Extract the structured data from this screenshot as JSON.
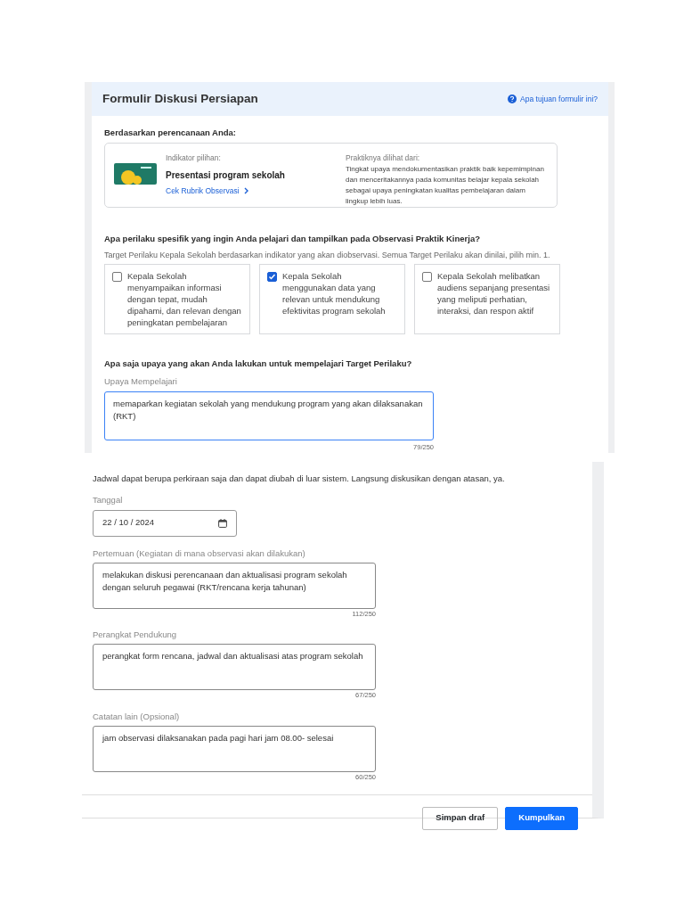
{
  "header": {
    "title": "Formulir Diskusi Persiapan",
    "help_link": "Apa tujuan formulir ini?"
  },
  "basis": {
    "heading": "Berdasarkan perencanaan Anda:",
    "indicator_label": "Indikator pilihan:",
    "indicator_name": "Presentasi program sekolah",
    "rubric_link": "Cek Rubrik Observasi",
    "practice_label": "Praktiknya dilihat dari:",
    "practice_text": "Tingkat upaya mendokumentasikan praktik baik kepemimpinan dan menceritakannya pada komunitas belajar kepala sekolah sebagai upaya peningkatan kualitas pembelajaran dalam lingkup lebih luas."
  },
  "behavior": {
    "heading": "Apa perilaku spesifik yang ingin Anda pelajari dan tampilkan pada Observasi Praktik Kinerja?",
    "hint": "Target Perilaku Kepala Sekolah berdasarkan indikator yang akan diobservasi. Semua Target Perilaku akan dinilai, pilih min. 1.",
    "options": [
      {
        "text": "Kepala Sekolah menyampaikan informasi dengan tepat, mudah dipahami, dan relevan dengan peningkatan pembelajaran",
        "checked": false
      },
      {
        "text": "Kepala Sekolah menggunakan data yang relevan untuk mendukung efektivitas program sekolah",
        "checked": true
      },
      {
        "text": "Kepala Sekolah melibatkan audiens sepanjang presentasi yang meliputi perhatian, interaksi, dan respon aktif",
        "checked": false
      }
    ]
  },
  "effort": {
    "heading": "Apa saja upaya yang akan Anda lakukan untuk mempelajari Target Perilaku?",
    "label": "Upaya Mempelajari",
    "value": "memaparkan kegiatan sekolah yang mendukung program yang akan dilaksanakan (RKT)",
    "counter": "79/250"
  },
  "schedule": {
    "note": "Jadwal dapat berupa perkiraan saja dan dapat diubah di luar sistem. Langsung diskusikan dengan atasan, ya.",
    "date_label": "Tanggal",
    "date_value": "22 / 10 / 2024",
    "fields": [
      {
        "label": "Pertemuan (Kegiatan di mana observasi akan dilakukan)",
        "value": "melakukan diskusi perencanaan dan aktualisasi program sekolah dengan seluruh pegawai (RKT/rencana kerja tahunan)",
        "counter": "112/250"
      },
      {
        "label": "Perangkat Pendukung",
        "value": "perangkat form rencana, jadwal dan aktualisasi atas program sekolah",
        "counter": "67/250"
      },
      {
        "label": "Catatan lain (Opsional)",
        "value": "jam observasi dilaksanakan pada pagi hari jam 08.00- selesai",
        "counter": "60/250"
      }
    ]
  },
  "buttons": [
    {
      "label": "Simpan draf",
      "kind": "secondary"
    },
    {
      "label": "Kumpulkan",
      "kind": "primary"
    }
  ]
}
